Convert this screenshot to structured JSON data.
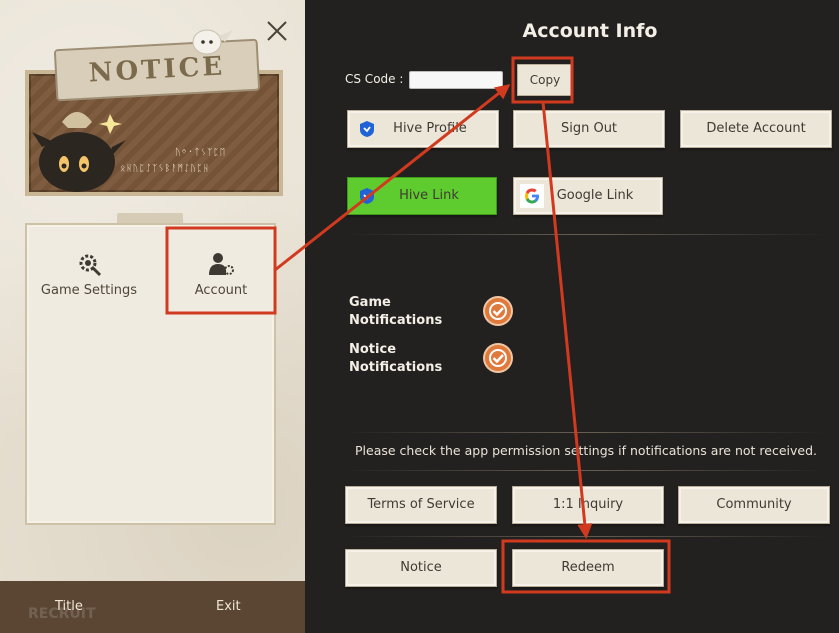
{
  "left_panel": {
    "banner_title": "NOTICE",
    "banner_runes_1": "ᚢᛜ᛫ᛏᛊᛉᛈᛖ",
    "banner_runes_2": "ᛟᚺᚢᛈᛇᛉᛊᛒᚨᛗᛇᚢᛈᚺ",
    "menu": [
      {
        "label": "Game Settings",
        "icon": "gear-wrench-icon"
      },
      {
        "label": "Account",
        "icon": "user-gear-icon"
      }
    ],
    "bottom": {
      "title_label": "Title",
      "exit_label": "Exit",
      "ghost_text": "RECRUIT"
    }
  },
  "account": {
    "title": "Account Info",
    "cs_code_label": "CS Code :",
    "cs_code_value": "",
    "copy_label": "Copy",
    "buttons_row1": [
      {
        "label": "Hive Profile",
        "icon": "hive-shield-icon"
      },
      {
        "label": "Sign Out"
      },
      {
        "label": "Delete Account"
      }
    ],
    "buttons_row2": [
      {
        "label": "Hive Link",
        "icon": "hive-shield-icon",
        "color": "#5ecc2e"
      },
      {
        "label": "Google Link",
        "icon": "google-g-icon"
      }
    ],
    "notifications": [
      {
        "label_line1": "Game",
        "label_line2": "Notifications",
        "checked": true
      },
      {
        "label_line1": "Notice",
        "label_line2": "Notifications",
        "checked": true
      }
    ],
    "permission_text": "Please check the app permission settings if notifications are not received.",
    "buttons_row3": [
      {
        "label": "Terms of Service"
      },
      {
        "label": "1:1 Inquiry"
      },
      {
        "label": "Community"
      }
    ],
    "buttons_row4": [
      {
        "label": "Notice"
      },
      {
        "label": "Redeem"
      }
    ]
  },
  "colors": {
    "annotation_red": "#d23a1f",
    "toggle_orange": "#e07a3c",
    "hive_green": "#5ecc2e"
  }
}
